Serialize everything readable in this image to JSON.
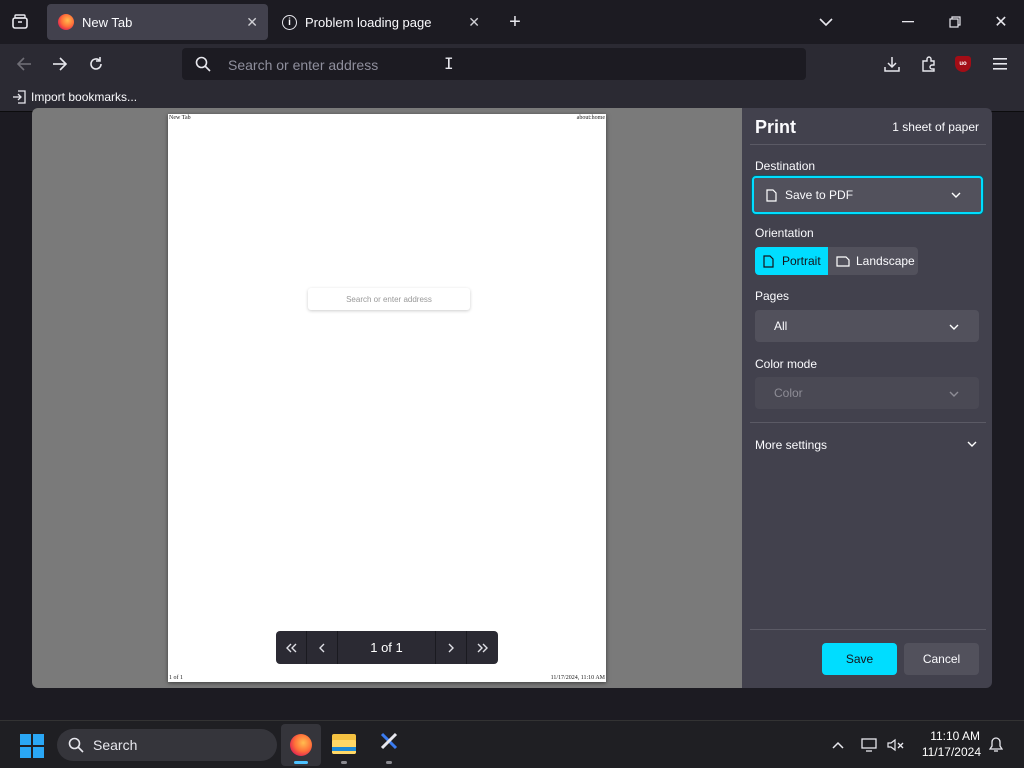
{
  "tabs": [
    {
      "title": "New Tab",
      "icon": "firefox-logo-icon"
    },
    {
      "title": "Problem loading page",
      "icon": "info-icon"
    }
  ],
  "address_bar": {
    "placeholder": "Search or enter address"
  },
  "bookmarks_bar": {
    "import_label": "Import bookmarks..."
  },
  "preview": {
    "header_left": "New Tab",
    "header_right": "about:home",
    "footer_left": "1 of 1",
    "footer_right": "11/17/2024, 11:10 AM",
    "page_search_placeholder": "Search or enter address",
    "page_indicator": "1 of 1"
  },
  "print_panel": {
    "title": "Print",
    "sheets": "1 sheet of paper",
    "destination_label": "Destination",
    "destination_value": "Save to PDF",
    "orientation_label": "Orientation",
    "portrait_label": "Portrait",
    "landscape_label": "Landscape",
    "pages_label": "Pages",
    "pages_value": "All",
    "color_mode_label": "Color mode",
    "color_mode_value": "Color",
    "more_settings_label": "More settings",
    "save_label": "Save",
    "cancel_label": "Cancel"
  },
  "taskbar": {
    "search_label": "Search",
    "time": "11:10 AM",
    "date": "11/17/2024"
  },
  "colors": {
    "accent": "#00ddff",
    "panel": "#42414d",
    "toolbar": "#2b2a33",
    "window": "#1c1b22"
  }
}
